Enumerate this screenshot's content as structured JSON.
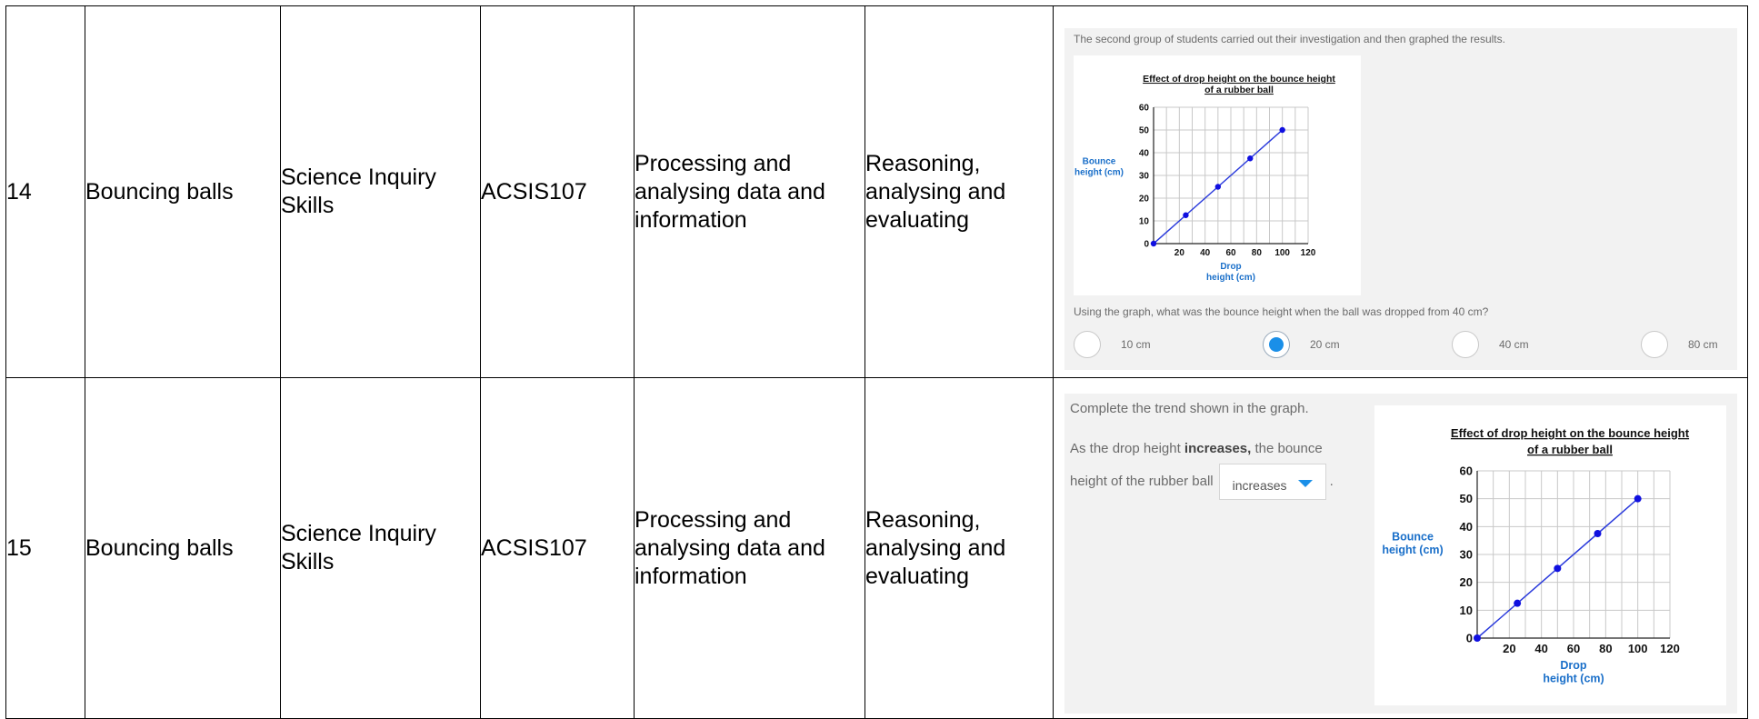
{
  "rows": [
    {
      "num": "14",
      "unit": "Bouncing balls",
      "strand": "Science Inquiry Skills",
      "code": "ACSIS107",
      "substrand": "Processing and analysing data and information",
      "skill": "Reasoning, analysing and evaluating",
      "question": {
        "intro": "The second group of students carried out their investigation and then graphed the results.",
        "prompt": "Using the graph, what was the bounce height when the ball was dropped from 40 cm?",
        "options": [
          {
            "label": "10 cm",
            "selected": false
          },
          {
            "label": "20 cm",
            "selected": true
          },
          {
            "label": "40 cm",
            "selected": false
          },
          {
            "label": "80 cm",
            "selected": false
          }
        ]
      }
    },
    {
      "num": "15",
      "unit": "Bouncing balls",
      "strand": "Science Inquiry Skills",
      "code": "ACSIS107",
      "substrand": "Processing and analysing data and information",
      "skill": "Reasoning, analysing and evaluating",
      "question": {
        "intro": "Complete the trend shown in the graph.",
        "sentence_part1": "As the drop height ",
        "sentence_bold": "increases,",
        "sentence_part2": " the bounce",
        "sentence_part3": "height of the rubber ball",
        "dropdown_value": "increases",
        "sentence_end": "."
      }
    }
  ],
  "chart_data": [
    {
      "type": "line",
      "title_line1": "Effect of drop height on the bounce height",
      "title_line2": "of a rubber ball",
      "xlabel_line1": "Drop",
      "xlabel_line2": "height (cm)",
      "ylabel_line1": "Bounce",
      "ylabel_line2": "height (cm)",
      "x": [
        0,
        25,
        50,
        75,
        100
      ],
      "y": [
        0,
        12.5,
        25,
        37.5,
        50
      ],
      "xlim": [
        0,
        120
      ],
      "ylim": [
        0,
        60
      ],
      "xticks": [
        20,
        40,
        60,
        80,
        100,
        120
      ],
      "yticks": [
        0,
        10,
        20,
        30,
        40,
        50,
        60
      ],
      "grid": true,
      "line_color": "#2b3bdc",
      "point_color": "#1010e0",
      "label_color": "#1a6fc9"
    },
    {
      "type": "line",
      "title_line1": "Effect of drop height on the bounce height",
      "title_line2": "of a rubber ball",
      "xlabel_line1": "Drop",
      "xlabel_line2": "height (cm)",
      "ylabel_line1": "Bounce",
      "ylabel_line2": "height (cm)",
      "x": [
        0,
        25,
        50,
        75,
        100
      ],
      "y": [
        0,
        12.5,
        25,
        37.5,
        50
      ],
      "xlim": [
        0,
        120
      ],
      "ylim": [
        0,
        60
      ],
      "xticks": [
        20,
        40,
        60,
        80,
        100,
        120
      ],
      "yticks": [
        0,
        10,
        20,
        30,
        40,
        50,
        60
      ],
      "grid": true,
      "line_color": "#2b3bdc",
      "point_color": "#1010e0",
      "label_color": "#1a6fc9"
    }
  ]
}
